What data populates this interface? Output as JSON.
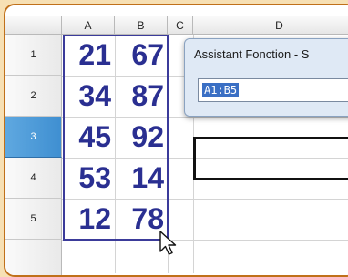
{
  "spreadsheet": {
    "column_headers": [
      "A",
      "B",
      "C",
      "D"
    ],
    "row_headers": [
      "1",
      "2",
      "3",
      "4",
      "5"
    ],
    "active_row": "3",
    "rows": [
      [
        "21",
        "67"
      ],
      [
        "34",
        "87"
      ],
      [
        "45",
        "92"
      ],
      [
        "53",
        "14"
      ],
      [
        "12",
        "78"
      ]
    ]
  },
  "dialog": {
    "title": "Assistant Fonction - S",
    "range_value": "A1:B5"
  },
  "colors": {
    "frame_border": "#c0701a",
    "background": "#f7e0b4",
    "cell_text": "#2a2f91",
    "active_row_header": "#3f8fd1",
    "selection_highlight": "#3a6fc4"
  },
  "icons": {
    "cursor": "mouse-pointer-icon"
  }
}
